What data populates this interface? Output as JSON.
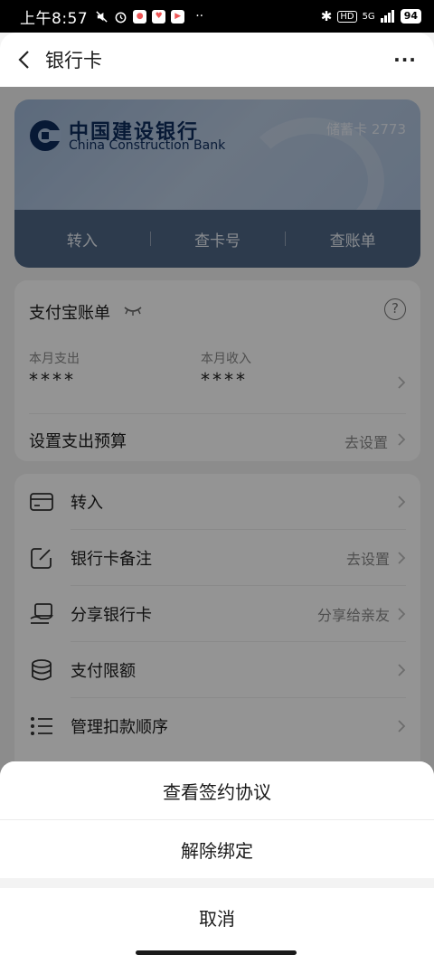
{
  "status_bar": {
    "time": "上午8:57",
    "network": "5G",
    "battery": "94"
  },
  "header": {
    "title": "银行卡",
    "more_label": "···"
  },
  "card": {
    "bank_name_cn": "中国建设银行",
    "bank_name_en": "China Construction Bank",
    "card_type": "储蓄卡 2773",
    "actions": [
      "转入",
      "查卡号",
      "查账单"
    ],
    "brand_color": "#0d2c5c"
  },
  "bill": {
    "title": "支付宝账单",
    "expense_label": "本月支出",
    "expense_value": "****",
    "income_label": "本月收入",
    "income_value": "****",
    "budget_label": "设置支出预算",
    "budget_action": "去设置"
  },
  "menu": {
    "items": [
      {
        "label": "转入",
        "right": "",
        "icon": "card-icon"
      },
      {
        "label": "银行卡备注",
        "right": "去设置",
        "icon": "edit-icon"
      },
      {
        "label": "分享银行卡",
        "right": "分享给亲友",
        "icon": "share-card-icon"
      },
      {
        "label": "支付限额",
        "right": "",
        "icon": "coins-icon"
      },
      {
        "label": "管理扣款顺序",
        "right": "",
        "icon": "list-icon"
      }
    ]
  },
  "sheet": {
    "view_agreement": "查看签约协议",
    "unbind": "解除绑定",
    "cancel": "取消"
  }
}
